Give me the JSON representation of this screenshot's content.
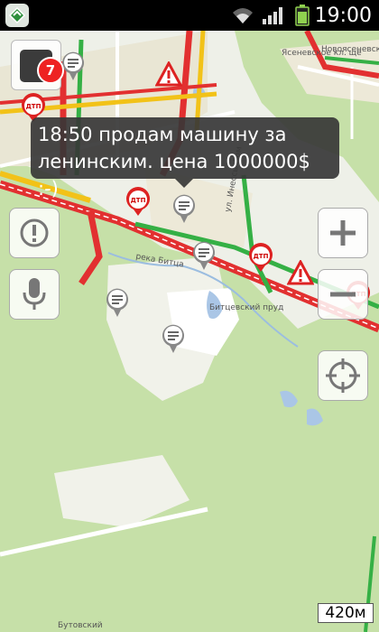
{
  "status_bar": {
    "time": "19:00",
    "icons": [
      "app-icon",
      "wifi-icon",
      "signal-icon",
      "battery-icon"
    ]
  },
  "map": {
    "labels": {
      "novosenevskaya": "Новоясеневска",
      "cemetery": "Ясеневское кл. ще",
      "street": "ул. Инессы Арм",
      "river": "река Битца",
      "pond": "Битцевский пруд",
      "butovsky": "Бутовский"
    },
    "scale": "420м",
    "colors": {
      "jam_red": "#e23030",
      "slow_yellow": "#f2c218",
      "free_green": "#35b045",
      "forest": "#c6e0a8",
      "water": "#aac6e6"
    }
  },
  "jam_widget": {
    "level": "7"
  },
  "tooltip": {
    "line1": "18:50 продам машину за",
    "line2": "ленинским. цена 1000000$ :-)"
  },
  "markers": {
    "dtp_label": "ДТП"
  },
  "controls": {
    "info": "info-icon",
    "mic": "microphone-icon",
    "zoom_in": "plus-icon",
    "zoom_out": "minus-icon",
    "locate": "locate-icon"
  }
}
